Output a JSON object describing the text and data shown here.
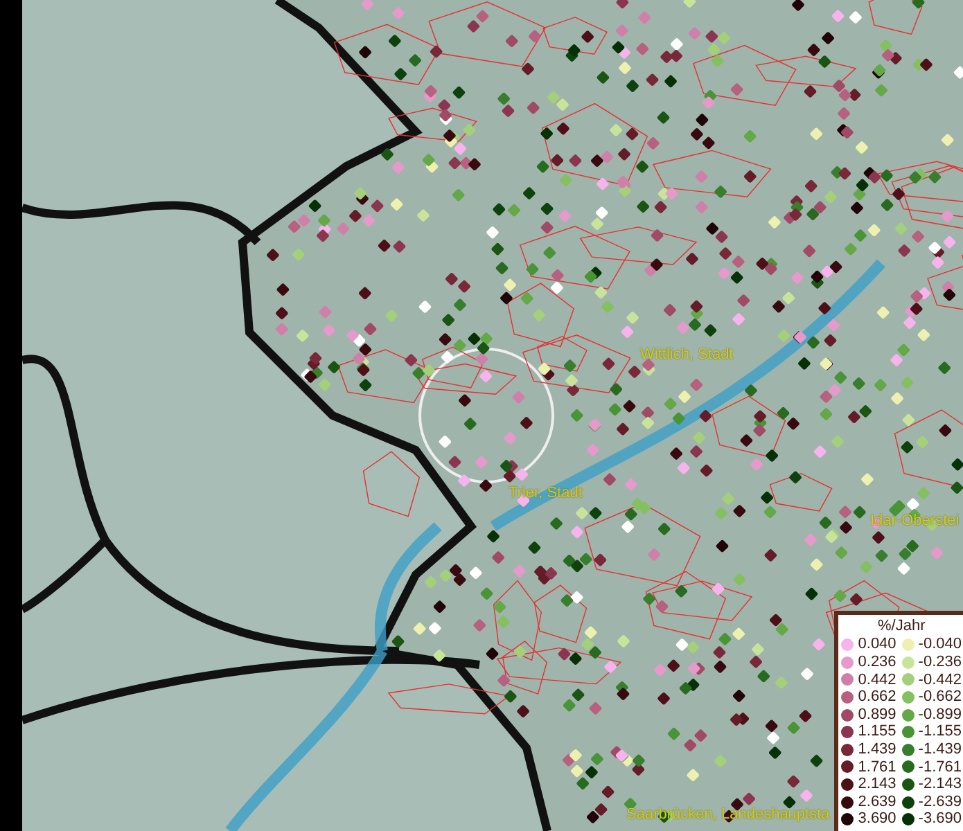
{
  "map": {
    "places": [
      {
        "name": "Wittlich, Stadt"
      },
      {
        "name": "Trier, Stadt"
      },
      {
        "name": "Idar-Oberstei"
      },
      {
        "name": "Saarbrücken, Landeshauptsta"
      }
    ]
  },
  "legend": {
    "title": "%/Jahr",
    "positive": [
      {
        "value": "0.040",
        "color": "#f7b3ec"
      },
      {
        "value": "0.236",
        "color": "#e59acb"
      },
      {
        "value": "0.442",
        "color": "#d080a8"
      },
      {
        "value": "0.662",
        "color": "#b8607f"
      },
      {
        "value": "0.899",
        "color": "#a04a68"
      },
      {
        "value": "1.155",
        "color": "#8c3550"
      },
      {
        "value": "1.439",
        "color": "#782838"
      },
      {
        "value": "1.761",
        "color": "#641c28"
      },
      {
        "value": "2.143",
        "color": "#4e1018"
      },
      {
        "value": "2.639",
        "color": "#380a10"
      },
      {
        "value": "3.690",
        "color": "#200408"
      }
    ],
    "negative": [
      {
        "value": "-0.040",
        "color": "#eef0b0"
      },
      {
        "value": "-0.236",
        "color": "#c8e49a"
      },
      {
        "value": "-0.442",
        "color": "#a4d07a"
      },
      {
        "value": "-0.662",
        "color": "#84c060"
      },
      {
        "value": "-0.899",
        "color": "#64a848"
      },
      {
        "value": "-1.155",
        "color": "#4a9438"
      },
      {
        "value": "-1.439",
        "color": "#387e2c"
      },
      {
        "value": "-1.761",
        "color": "#286a20"
      },
      {
        "value": "-2.143",
        "color": "#1a5514"
      },
      {
        "value": "-2.639",
        "color": "#0e420c"
      },
      {
        "value": "-3.690",
        "color": "#063006"
      }
    ]
  }
}
